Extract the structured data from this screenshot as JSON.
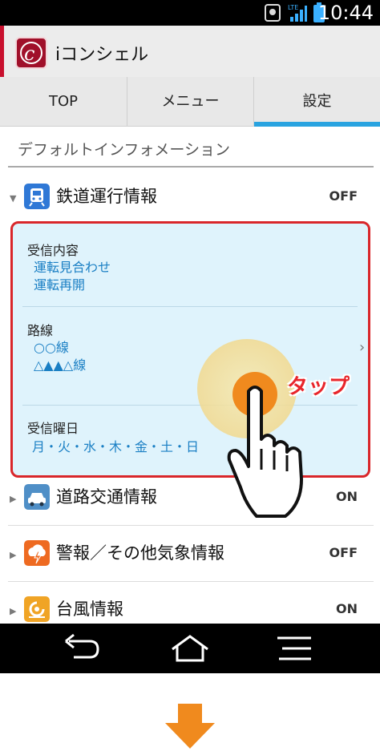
{
  "status_bar": {
    "time": "10:44",
    "signal_label": "LTE",
    "icons": [
      "notification-icon",
      "lte-signal-icon",
      "battery-icon"
    ]
  },
  "app": {
    "title": "iコンシェル",
    "logo_icon": "iconcier-logo-icon",
    "accent_color": "#c8102e"
  },
  "tabs": [
    {
      "label": "TOP",
      "selected": false
    },
    {
      "label": "メニュー",
      "selected": false
    },
    {
      "label": "設定",
      "selected": true
    }
  ],
  "section_title": "デフォルトインフォメーション",
  "rows": [
    {
      "label": "鉄道運行情報",
      "state": "OFF",
      "icon": "train-icon",
      "expanded": true,
      "icon_color": "#2f78d6"
    },
    {
      "label": "道路交通情報",
      "state": "ON",
      "icon": "car-icon",
      "expanded": false,
      "icon_color": "#4f8fc7"
    },
    {
      "label": "警報／その他気象情報",
      "state": "OFF",
      "icon": "weather-warning-icon",
      "expanded": false,
      "icon_color": "#ee6a21"
    },
    {
      "label": "台風情報",
      "state": "ON",
      "icon": "typhoon-icon",
      "expanded": false,
      "icon_color": "#f0a425"
    }
  ],
  "panel": {
    "receive_content": {
      "heading": "受信内容",
      "values": [
        "運転見合わせ",
        "運転再開"
      ]
    },
    "route": {
      "heading": "路線",
      "values": [
        "○○線",
        "△▲▲△線"
      ]
    },
    "receive_days": {
      "heading": "受信曜日",
      "value": "月・火・水・木・金・土・日"
    }
  },
  "overlay": {
    "tap_label": "タップ",
    "hand_icon": "tap-hand-icon",
    "tap_color": "#f08a1e"
  },
  "nav_bar": {
    "icons": [
      "back-icon",
      "home-icon",
      "menu-icon"
    ]
  },
  "next_step_arrow": {
    "icon": "down-arrow-icon",
    "color": "#f08a1e"
  }
}
